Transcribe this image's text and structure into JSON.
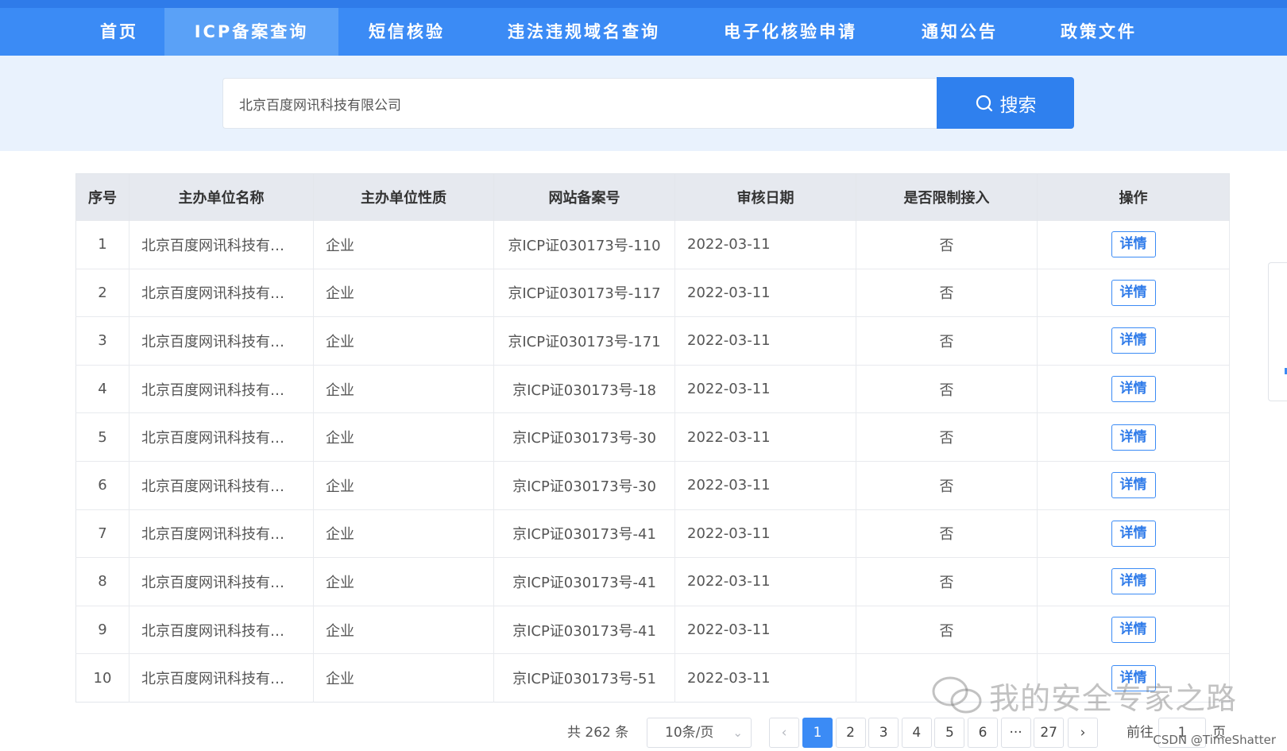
{
  "nav": {
    "items": [
      {
        "label": "首页"
      },
      {
        "label": "ICP备案查询"
      },
      {
        "label": "短信核验"
      },
      {
        "label": "违法违规域名查询"
      },
      {
        "label": "电子化核验申请"
      },
      {
        "label": "通知公告"
      },
      {
        "label": "政策文件"
      }
    ],
    "active_index": 1
  },
  "search": {
    "value": "北京百度网讯科技有限公司",
    "button_label": "搜索"
  },
  "table": {
    "headers": [
      "序号",
      "主办单位名称",
      "主办单位性质",
      "网站备案号",
      "审核日期",
      "是否限制接入",
      "操作"
    ],
    "rows": [
      {
        "idx": "1",
        "name": "北京百度网讯科技有…",
        "type": "企业",
        "icp": "京ICP证030173号-110",
        "date": "2022-03-11",
        "limited": "否",
        "action": "详情"
      },
      {
        "idx": "2",
        "name": "北京百度网讯科技有…",
        "type": "企业",
        "icp": "京ICP证030173号-117",
        "date": "2022-03-11",
        "limited": "否",
        "action": "详情"
      },
      {
        "idx": "3",
        "name": "北京百度网讯科技有…",
        "type": "企业",
        "icp": "京ICP证030173号-171",
        "date": "2022-03-11",
        "limited": "否",
        "action": "详情"
      },
      {
        "idx": "4",
        "name": "北京百度网讯科技有…",
        "type": "企业",
        "icp": "京ICP证030173号-18",
        "date": "2022-03-11",
        "limited": "否",
        "action": "详情"
      },
      {
        "idx": "5",
        "name": "北京百度网讯科技有…",
        "type": "企业",
        "icp": "京ICP证030173号-30",
        "date": "2022-03-11",
        "limited": "否",
        "action": "详情"
      },
      {
        "idx": "6",
        "name": "北京百度网讯科技有…",
        "type": "企业",
        "icp": "京ICP证030173号-30",
        "date": "2022-03-11",
        "limited": "否",
        "action": "详情"
      },
      {
        "idx": "7",
        "name": "北京百度网讯科技有…",
        "type": "企业",
        "icp": "京ICP证030173号-41",
        "date": "2022-03-11",
        "limited": "否",
        "action": "详情"
      },
      {
        "idx": "8",
        "name": "北京百度网讯科技有…",
        "type": "企业",
        "icp": "京ICP证030173号-41",
        "date": "2022-03-11",
        "limited": "否",
        "action": "详情"
      },
      {
        "idx": "9",
        "name": "北京百度网讯科技有…",
        "type": "企业",
        "icp": "京ICP证030173号-41",
        "date": "2022-03-11",
        "limited": "否",
        "action": "详情"
      },
      {
        "idx": "10",
        "name": "北京百度网讯科技有…",
        "type": "企业",
        "icp": "京ICP证030173号-51",
        "date": "2022-03-11",
        "limited": "",
        "action": "详情"
      }
    ]
  },
  "pagination": {
    "total_text": "共 262 条",
    "page_size": "10条/页",
    "pages": [
      "1",
      "2",
      "3",
      "4",
      "5",
      "6",
      "···",
      "27"
    ],
    "current_page": "1",
    "goto_label": "前往",
    "goto_value": "1",
    "goto_suffix": "页"
  },
  "watermark": {
    "text": "我的安全专家之路",
    "credit": "CSDN @TimeShatter"
  },
  "colors": {
    "nav_bg": "#3b8bf5",
    "nav_active": "#5aa1f7",
    "accent": "#2f80ee",
    "band_bg": "#e9f2fd"
  }
}
